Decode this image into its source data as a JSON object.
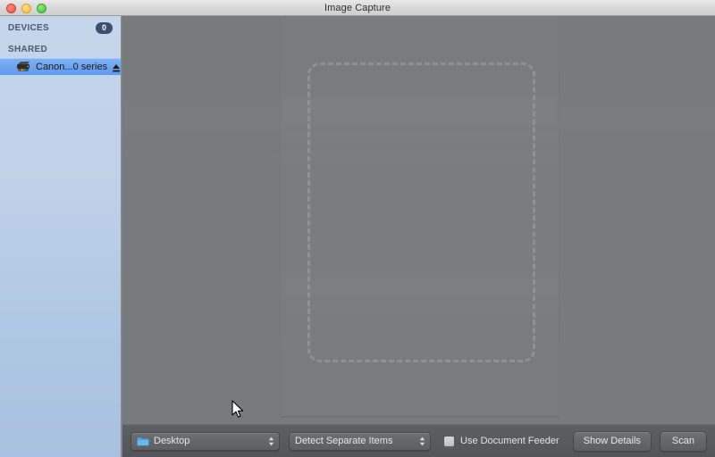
{
  "window": {
    "title": "Image Capture",
    "controls": {
      "close": "close-button",
      "minimize": "minimize-button",
      "zoom": "zoom-button"
    }
  },
  "sidebar": {
    "sections": [
      {
        "label": "DEVICES",
        "badge": "0",
        "items": []
      },
      {
        "label": "SHARED",
        "badge": "",
        "items": [
          {
            "label": "Canon...0 series",
            "icon": "scanner-icon",
            "eject": "eject-icon",
            "selected": true
          }
        ]
      }
    ]
  },
  "preview": {
    "selection_label": "scan-selection-marquee",
    "cursor": "arrow-cursor"
  },
  "toolbar": {
    "destination": {
      "value": "Desktop",
      "icon": "folder-icon"
    },
    "scan_mode": {
      "value": "Detect Separate Items"
    },
    "document_feeder": {
      "label": "Use Document Feeder",
      "checked": false
    },
    "show_details_label": "Show Details",
    "scan_label": "Scan"
  },
  "colors": {
    "selection_blue": "#5f9aee",
    "badge_navy": "#39506e",
    "folder_blue": "#5aa9e6",
    "preview_gray": "#787b7e",
    "toolbar_gray": "#585b5e"
  }
}
